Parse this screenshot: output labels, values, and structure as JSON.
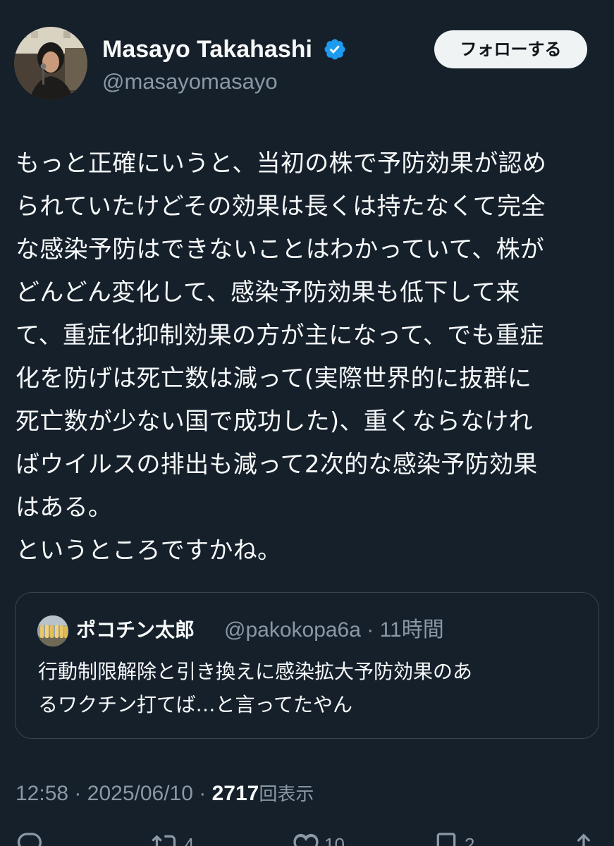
{
  "author": {
    "display_name": "Masayo Takahashi",
    "handle": "@masayomasayo",
    "verified": true,
    "avatar_icon": "profile-photo"
  },
  "follow_button": {
    "label": "フォローする"
  },
  "tweet": {
    "lines": [
      "もっと正確にいうと、当初の株で予防効果が認め",
      "られていたけどその効果は長くは持たなくて完全",
      "な感染予防はできないことはわかっていて、株が",
      "どんどん変化して、感染予防効果も低下して来",
      "て、重症化抑制効果の方が主になって、でも重症",
      "化を防げは死亡数は減って(実際世界的に抜群に",
      "死亡数が少ない国で成功した)、重くならなけれ",
      "ばウイルスの排出も減って2次的な感染予防効果",
      "はある。",
      "というところですかね。"
    ]
  },
  "quote": {
    "display_name": "ポコチン太郎",
    "meta": "@pakokopa6a · 11時間",
    "lines": [
      "行動制限解除と引き換えに感染拡大予防効果のあ",
      "るワクチン打てば…と言ってたやん"
    ]
  },
  "timestamp": {
    "time": "12:58",
    "separator": "·",
    "date": "2025/06/10",
    "views_count": "2717",
    "views_label": "回表示"
  },
  "actions": {
    "reply_icon": "reply-icon",
    "retweet_icon": "retweet-icon",
    "retweet_count": "4",
    "like_icon": "heart-icon",
    "like_count": "10",
    "bookmark_icon": "bookmark-icon",
    "bookmark_count": "2",
    "share_icon": "share-icon"
  },
  "colors": {
    "background": "#15202b",
    "text_primary": "#f7f9f9",
    "text_secondary": "#8b98a5",
    "verified_badge": "#1d9bf0",
    "border": "#38444d"
  }
}
